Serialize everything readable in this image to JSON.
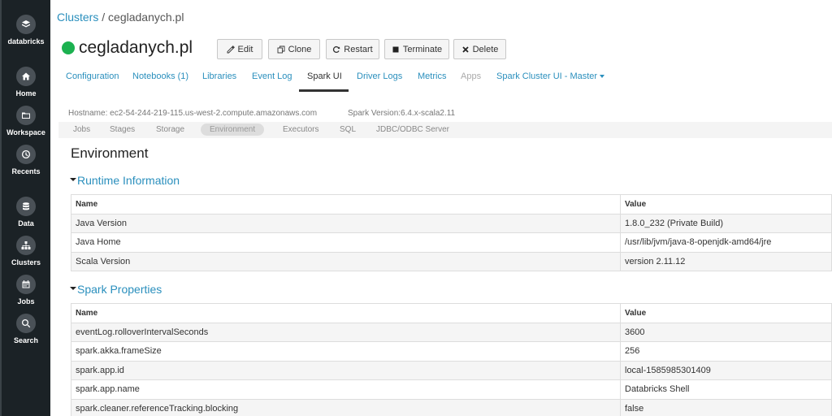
{
  "sidebar": {
    "logo_label": "databricks",
    "items": [
      {
        "label": "Home",
        "icon": "home-icon"
      },
      {
        "label": "Workspace",
        "icon": "folder-icon"
      },
      {
        "label": "Recents",
        "icon": "clock-icon"
      },
      {
        "label": "Data",
        "icon": "database-icon"
      },
      {
        "label": "Clusters",
        "icon": "clusters-icon"
      },
      {
        "label": "Jobs",
        "icon": "calendar-icon"
      },
      {
        "label": "Search",
        "icon": "search-icon"
      }
    ]
  },
  "breadcrumb": {
    "parent": "Clusters",
    "separator": " / ",
    "current": "cegladanych.pl"
  },
  "cluster": {
    "name": "cegladanych.pl",
    "status_color": "#1cb150"
  },
  "actions": {
    "edit": "Edit",
    "clone": "Clone",
    "restart": "Restart",
    "terminate": "Terminate",
    "delete": "Delete"
  },
  "tabs": {
    "configuration": "Configuration",
    "notebooks": "Notebooks (1)",
    "libraries": "Libraries",
    "event_log": "Event Log",
    "spark_ui": "Spark UI",
    "driver_logs": "Driver Logs",
    "metrics": "Metrics",
    "apps": "Apps",
    "spark_cluster_ui": "Spark Cluster UI - Master",
    "active": "Spark UI"
  },
  "spark_info": {
    "hostname": "Hostname: ec2-54-244-219-115.us-west-2.compute.amazonaws.com",
    "version": "Spark Version:6.4.x-scala2.11"
  },
  "subnav": {
    "jobs": "Jobs",
    "stages": "Stages",
    "storage": "Storage",
    "environment": "Environment",
    "executors": "Executors",
    "sql": "SQL",
    "jdbc": "JDBC/ODBC Server",
    "active": "Environment"
  },
  "page": {
    "title": "Environment"
  },
  "runtime": {
    "title": "Runtime Information",
    "headers": {
      "name": "Name",
      "value": "Value"
    },
    "rows": [
      {
        "name": "Java Version",
        "value": "1.8.0_232 (Private Build)"
      },
      {
        "name": "Java Home",
        "value": "/usr/lib/jvm/java-8-openjdk-amd64/jre"
      },
      {
        "name": "Scala Version",
        "value": "version 2.11.12"
      }
    ]
  },
  "spark_properties": {
    "title": "Spark Properties",
    "headers": {
      "name": "Name",
      "value": "Value"
    },
    "rows": [
      {
        "name": "eventLog.rolloverIntervalSeconds",
        "value": "3600"
      },
      {
        "name": "spark.akka.frameSize",
        "value": "256"
      },
      {
        "name": "spark.app.id",
        "value": "local-1585985301409"
      },
      {
        "name": "spark.app.name",
        "value": "Databricks Shell"
      },
      {
        "name": "spark.cleaner.referenceTracking.blocking",
        "value": "false"
      }
    ]
  }
}
